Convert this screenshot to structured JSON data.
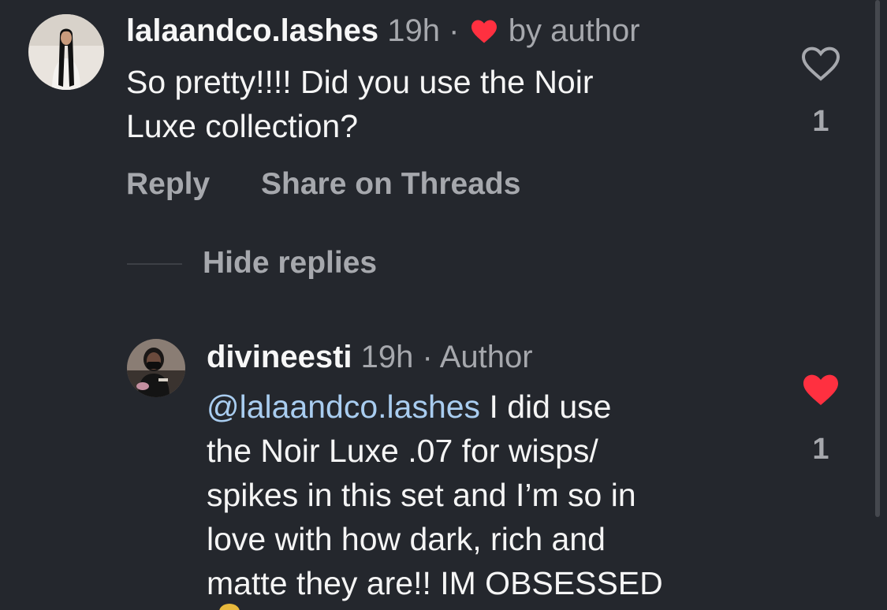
{
  "comments": [
    {
      "username": "lalaandco.lashes",
      "time": "19h",
      "separator": "·",
      "liked_by_author_label": "by author",
      "text_lines": [
        "So pretty!!!! Did you use the Noir",
        "Luxe collection?"
      ],
      "like_count": "1",
      "liked": false,
      "actions": {
        "reply_label": "Reply",
        "share_label": "Share on Threads"
      },
      "hide_replies_label": "Hide replies",
      "avatar_icon": "profile-photo-woman-long-hair-white-dress"
    },
    {
      "username": "divineesti",
      "time": "19h",
      "separator": "·",
      "author_tag": "Author",
      "mention": "@lalaandco.lashes",
      "text_lines": [
        " I did use",
        "the Noir Luxe .07 for wisps/",
        "spikes in this set and I’m so in",
        "love with how dark, rich and",
        "matte they are!! IM OBSESSED"
      ],
      "like_count": "1",
      "liked": true,
      "avatar_icon": "profile-photo-woman-face-mask"
    }
  ],
  "colors": {
    "background": "#24272d",
    "primary_text": "#f5f5f5",
    "secondary_text": "#a6a8ad",
    "mention": "#a9cdf0",
    "heart_red": "#ff3040"
  },
  "icons": {
    "inline_heart": "red-heart-icon",
    "like_outline": "heart-outline-icon",
    "like_filled": "heart-filled-icon"
  }
}
